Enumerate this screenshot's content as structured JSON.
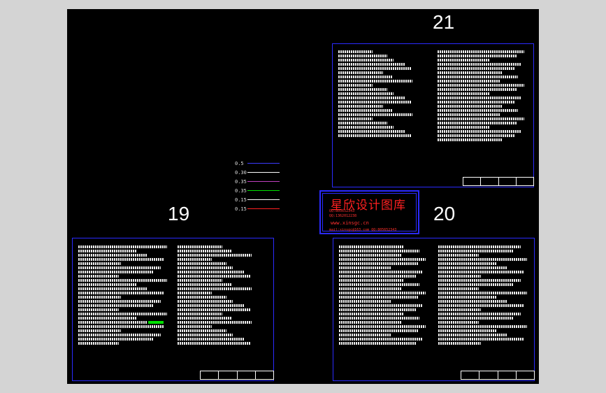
{
  "sheets": {
    "s21": {
      "number": "21"
    },
    "s19": {
      "number": "19"
    },
    "s20": {
      "number": "20"
    }
  },
  "legend": [
    {
      "label": "0.5",
      "color": "#3a3aff"
    },
    {
      "label": "0.30",
      "color": "#ffffff"
    },
    {
      "label": "0.35",
      "color": "#c040c0"
    },
    {
      "label": "0.35",
      "color": "#00e000"
    },
    {
      "label": "0.15",
      "color": "#ffffff"
    },
    {
      "label": "0.15",
      "color": "#ff2020"
    }
  ],
  "watermark": {
    "title": "星欣设计图库",
    "line1": "QQ:805652343",
    "line2": "QQ:1362012238",
    "url": "www.xinsgc.cn",
    "email": "mail:xinsgc@163.com QQ:805652343"
  },
  "colors": {
    "sheet_border": "#2b2bff",
    "canvas": "#000000",
    "frame": "#d4d4d4"
  }
}
